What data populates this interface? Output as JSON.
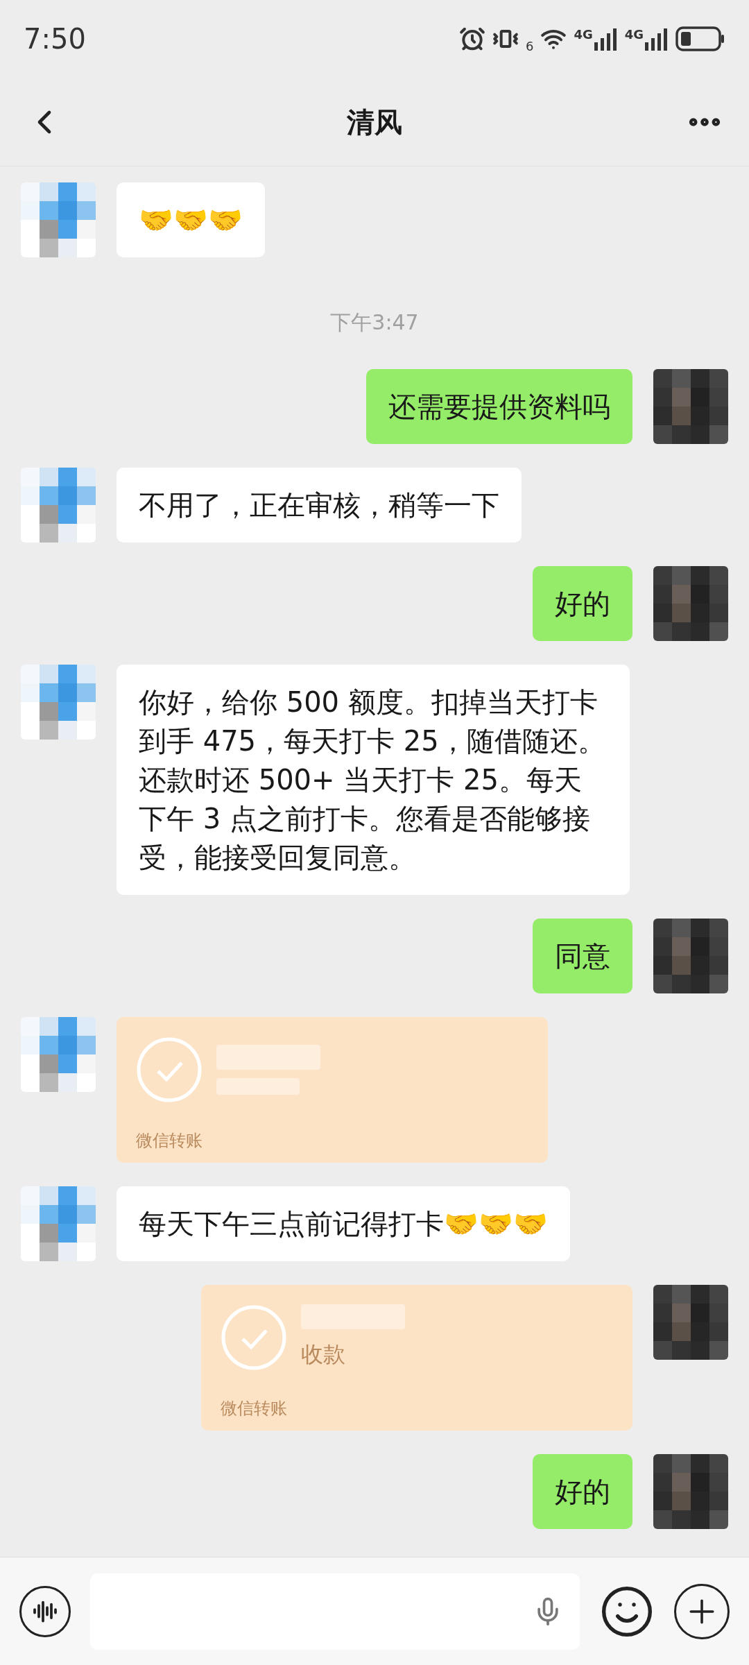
{
  "status_bar": {
    "time": "7:50",
    "wifi_label": "6",
    "signals": [
      "4G",
      "4G"
    ]
  },
  "header": {
    "title": "清风"
  },
  "messages": [
    {
      "kind": "text",
      "outgoing": false,
      "text": "🤝🤝🤝"
    },
    {
      "kind": "time",
      "text": "下午3:47"
    },
    {
      "kind": "text",
      "outgoing": true,
      "text": "还需要提供资料吗"
    },
    {
      "kind": "text",
      "outgoing": false,
      "text": "不用了，正在审核，稍等一下"
    },
    {
      "kind": "text",
      "outgoing": true,
      "text": "好的"
    },
    {
      "kind": "text",
      "outgoing": false,
      "text": "你好，给你 500 额度。扣掉当天打卡到手 475，每天打卡 25，随借随还。还款时还 500+ 当天打卡 25。每天下午 3 点之前打卡。您看是否能够接受，能接受回复同意。"
    },
    {
      "kind": "text",
      "outgoing": true,
      "text": "同意"
    },
    {
      "kind": "transfer",
      "outgoing": false,
      "footer": "微信转账"
    },
    {
      "kind": "text",
      "outgoing": false,
      "text": "每天下午三点前记得打卡🤝🤝🤝"
    },
    {
      "kind": "transfer",
      "outgoing": true,
      "status": "收款",
      "footer": "微信转账"
    },
    {
      "kind": "text",
      "outgoing": true,
      "text": "好的"
    }
  ]
}
